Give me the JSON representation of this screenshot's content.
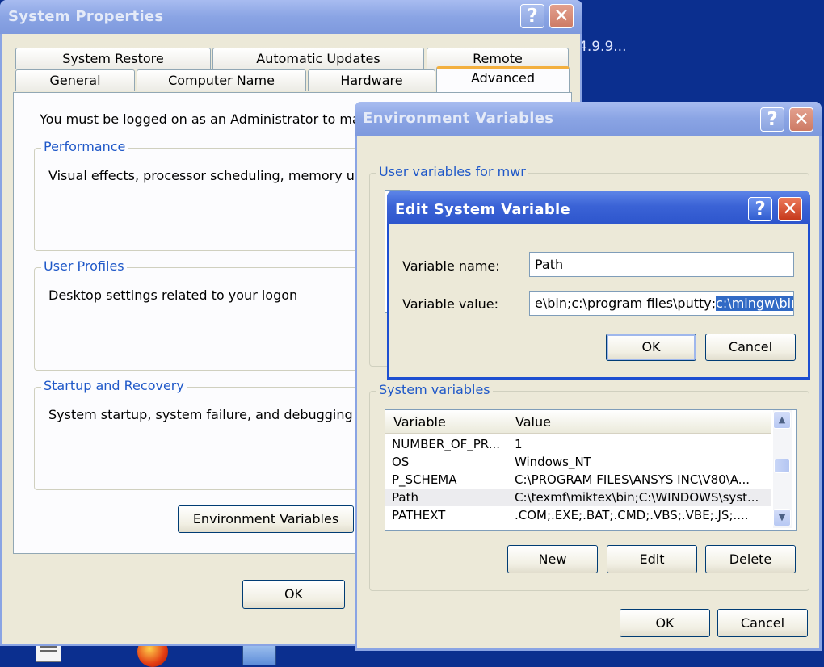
{
  "desktop": {
    "partial_text": "4.9.9..."
  },
  "system_properties": {
    "title": "System Properties",
    "help_glyph": "?",
    "close_glyph": "✕",
    "tabs_row1": [
      "System Restore",
      "Automatic Updates",
      "Remote"
    ],
    "tabs_row2": [
      "General",
      "Computer Name",
      "Hardware",
      "Advanced"
    ],
    "active_tab": "Advanced",
    "admin_notice": "You must be logged on as an Administrator to make",
    "performance": {
      "legend": "Performance",
      "desc": "Visual effects, processor scheduling, memory usa"
    },
    "user_profiles": {
      "legend": "User Profiles",
      "desc": "Desktop settings related to your logon"
    },
    "startup": {
      "legend": "Startup and Recovery",
      "desc": "System startup, system failure, and debugging info"
    },
    "env_button": "Environment Variables",
    "ok_button": "OK"
  },
  "environment_variables": {
    "title": "Environment Variables",
    "user_vars_legend": "User variables for mwr",
    "system_vars_legend": "System variables",
    "columns": [
      "Variable",
      "Value"
    ],
    "rows": [
      {
        "variable": "NUMBER_OF_PR...",
        "value": "1"
      },
      {
        "variable": "OS",
        "value": "Windows_NT"
      },
      {
        "variable": "P_SCHEMA",
        "value": "C:\\PROGRAM FILES\\ANSYS INC\\V80\\A..."
      },
      {
        "variable": "Path",
        "value": "C:\\texmf\\miktex\\bin;C:\\WINDOWS\\syst..."
      },
      {
        "variable": "PATHEXT",
        "value": ".COM;.EXE;.BAT;.CMD;.VBS;.VBE;.JS;...."
      }
    ],
    "selected_row": "Path",
    "new_button": "New",
    "edit_button": "Edit",
    "delete_button": "Delete",
    "ok_button": "OK",
    "cancel_button": "Cancel"
  },
  "edit_variable": {
    "title": "Edit System Variable",
    "name_label": "Variable name:",
    "name_value": "Path",
    "value_label": "Variable value:",
    "value_text": "e\\bin;c:\\program files\\putty;",
    "value_selected": "c:\\mingw\\bin",
    "ok_button": "OK",
    "cancel_button": "Cancel"
  },
  "colors": {
    "titlebar_active": "#2d55cc",
    "titlebar_inactive": "#8aa4e4",
    "dialog_face": "#ece9d8",
    "group_legend": "#1f58c8",
    "selection": "#316ac5",
    "desktop": "#0b2f8f"
  }
}
